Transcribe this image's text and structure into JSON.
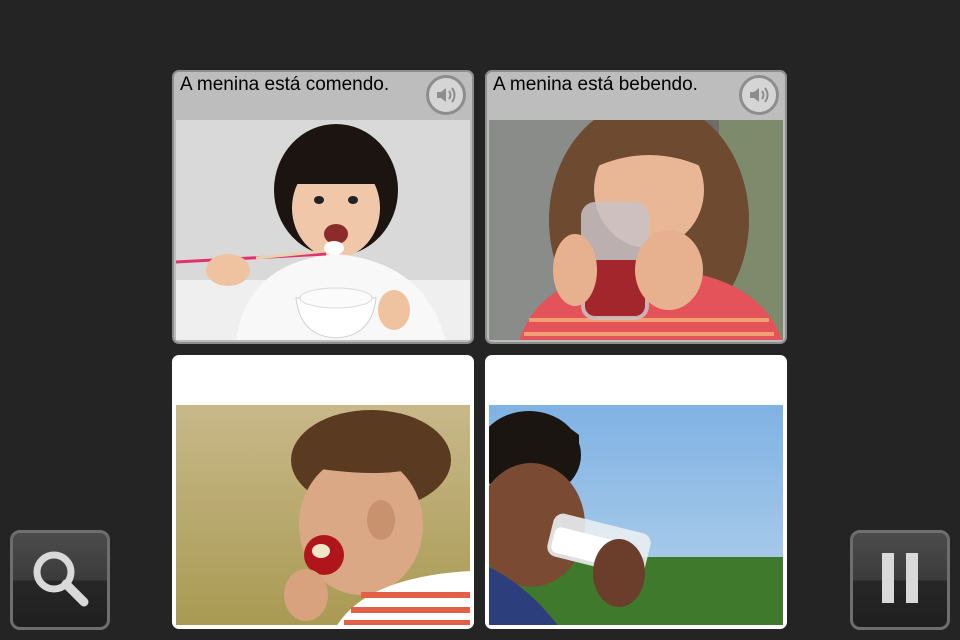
{
  "cards": [
    {
      "caption": "A menina está comendo.",
      "photo_icon": "girl-eating-rice-photo",
      "speaker_icon": "speaker-icon"
    },
    {
      "caption": "A menina está bebendo.",
      "photo_icon": "girl-drinking-juice-photo",
      "speaker_icon": "speaker-icon"
    },
    {
      "caption": "",
      "photo_icon": "boy-eating-apple-photo"
    },
    {
      "caption": "",
      "photo_icon": "boy-drinking-milk-photo"
    }
  ],
  "controls": {
    "left": {
      "icon": "magnifier-icon"
    },
    "right": {
      "icon": "pause-icon"
    }
  },
  "colors": {
    "background": "#242424",
    "answered_card": "#bdbdbd",
    "blank_card": "#ffffff"
  }
}
